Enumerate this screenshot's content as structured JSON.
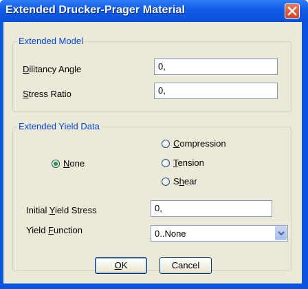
{
  "window": {
    "title": "Extended Drucker-Prager Material"
  },
  "extended_model": {
    "group_title": "Extended Model",
    "dilitancy_label_mnemonic": "D",
    "dilitancy_label_rest": "ilitancy Angle",
    "dilitancy_value": "0,",
    "stress_ratio_label_mnemonic": "S",
    "stress_ratio_label_rest": "tress Ratio",
    "stress_ratio_value": "0,"
  },
  "extended_yield": {
    "group_title": "Extended Yield Data",
    "radio_none_mnemonic": "N",
    "radio_none_rest": "one",
    "radio_compression_mnemonic": "C",
    "radio_compression_rest": "ompression",
    "radio_tension_mnemonic": "T",
    "radio_tension_rest": "ension",
    "radio_shear_pre": "S",
    "radio_shear_mnemonic": "h",
    "radio_shear_rest": "ear",
    "selected": "None",
    "initial_yield_label_pre": "Initial ",
    "initial_yield_label_mnemonic": "Y",
    "initial_yield_label_rest": "ield Stress",
    "initial_yield_value": "0,",
    "yield_function_label_pre": "Yield ",
    "yield_function_label_mnemonic": "F",
    "yield_function_label_rest": "unction",
    "yield_function_value": "0..None"
  },
  "buttons": {
    "ok_mnemonic": "O",
    "ok_rest": "K",
    "cancel": "Cancel"
  },
  "icons": {
    "close": "close-icon",
    "dropdown": "chevron-down-icon"
  },
  "colors": {
    "titlebar": "#0a54e0",
    "group_title": "#0046d5",
    "dialog_bg": "#ece9d8",
    "close": "#d2441f"
  }
}
